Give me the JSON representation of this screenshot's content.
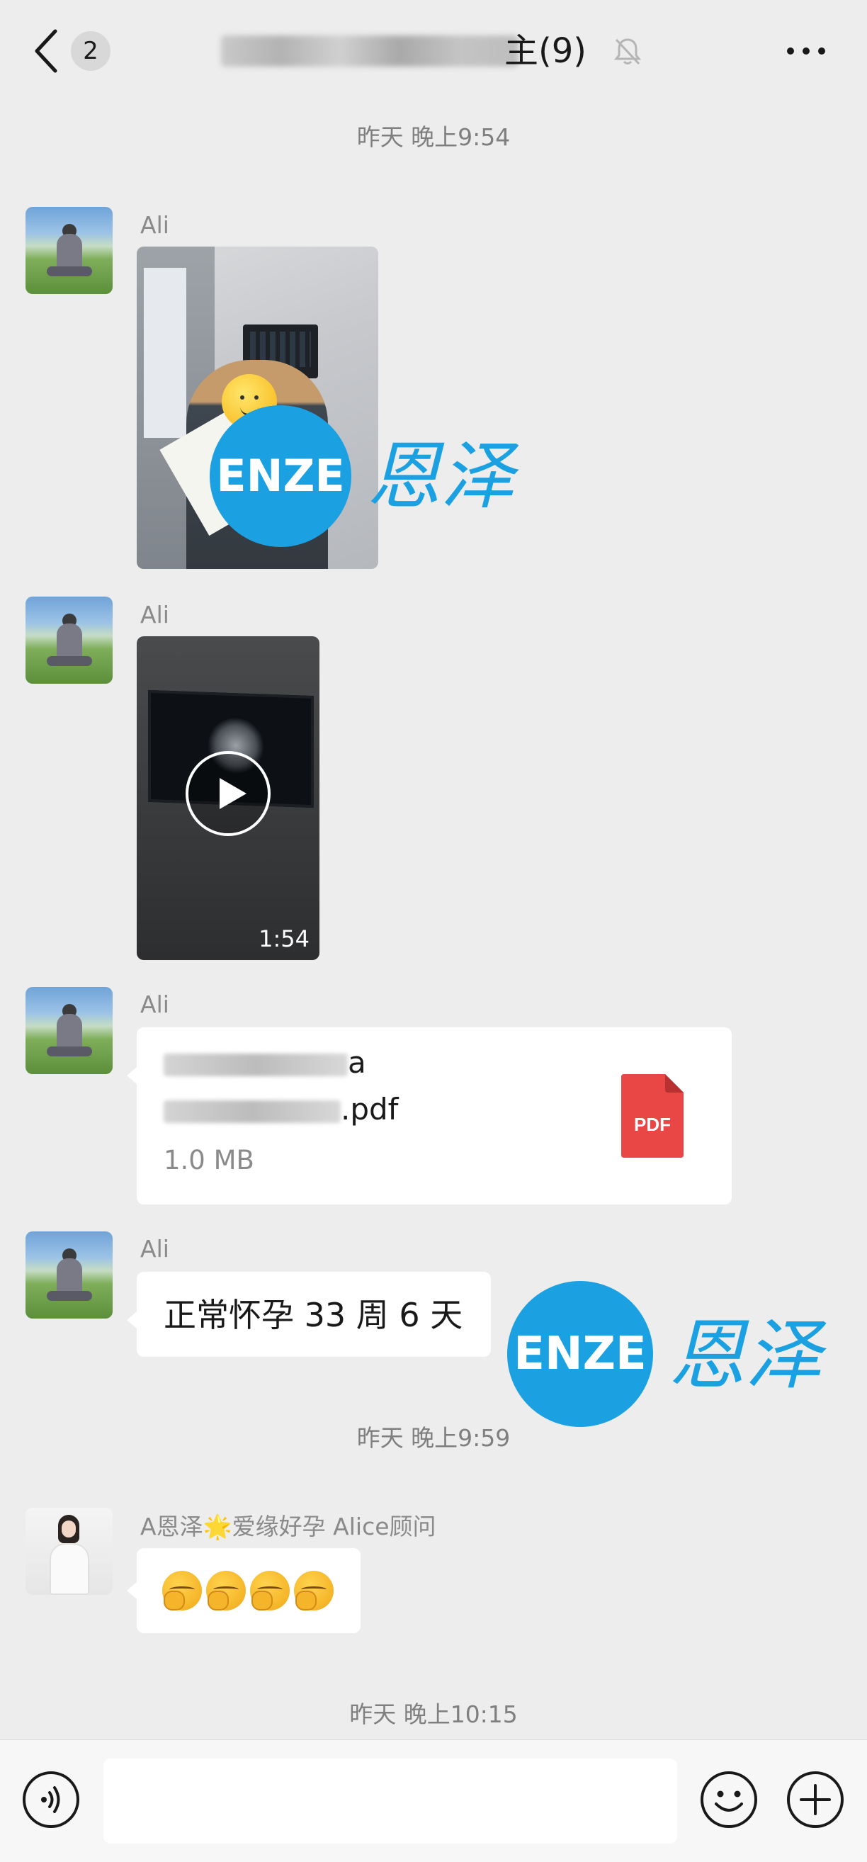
{
  "header": {
    "unread_count": "2",
    "title_visible": "主(9)",
    "icons": {
      "back": "back-chevron-icon",
      "mute": "bell-muted-icon",
      "more": "more-dots-icon"
    }
  },
  "messages": {
    "timestamp_1": "昨天 晚上9:54",
    "msg1": {
      "sender": "Ali",
      "type": "image"
    },
    "msg2": {
      "sender": "Ali",
      "type": "video",
      "duration": "1:54"
    },
    "msg3": {
      "sender": "Ali",
      "type": "file",
      "file_line_1": "а",
      "file_line_2": ".pdf",
      "file_size": "1.0 MB",
      "file_icon_label": "PDF"
    },
    "msg4": {
      "sender": "Ali",
      "type": "text",
      "text": "正常怀孕 33 周 6 天"
    },
    "timestamp_2": "昨天 晚上9:59",
    "msg5": {
      "sender": "A恩泽🌟爱缘好孕 Alice顾问",
      "type": "emoji",
      "emoji_count": 4
    },
    "timestamp_3": "昨天 晚上10:15"
  },
  "watermark": {
    "logo_text": "ENZE",
    "chinese_text": "恩泽",
    "color": "#1ba1e2"
  },
  "input_bar": {
    "input_value": "",
    "icons": {
      "voice": "voice-icon",
      "emoji": "smiley-icon",
      "plus": "plus-icon"
    }
  },
  "colors": {
    "background": "#ededed",
    "bubble": "#ffffff",
    "pdf_red": "#e94646",
    "timestamp": "#7f7f7f"
  }
}
